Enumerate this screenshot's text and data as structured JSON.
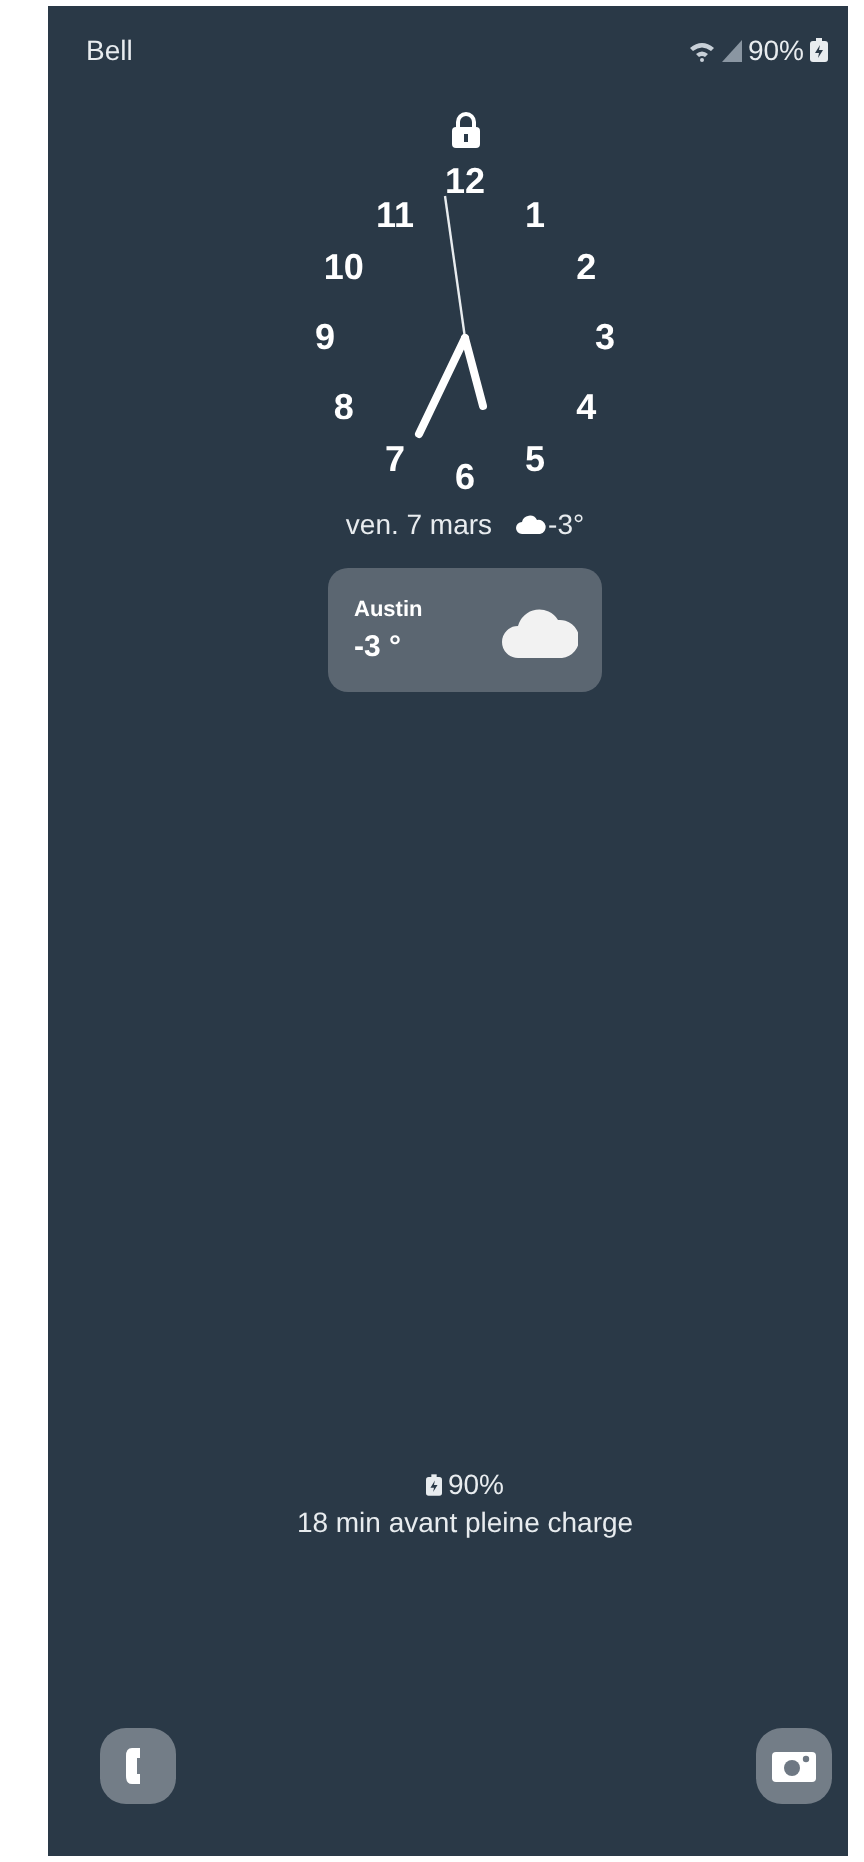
{
  "status_bar": {
    "carrier": "Bell",
    "battery": "90%"
  },
  "clock": {
    "numerals": [
      "12",
      "1",
      "2",
      "3",
      "4",
      "5",
      "6",
      "7",
      "8",
      "9",
      "10",
      "11"
    ]
  },
  "date": "ven. 7 mars",
  "weather_summary": "-3°",
  "weather_card": {
    "city": "Austin",
    "temperature": "-3 °"
  },
  "charging": {
    "percent": "90%",
    "message": "18 min avant pleine charge"
  }
}
